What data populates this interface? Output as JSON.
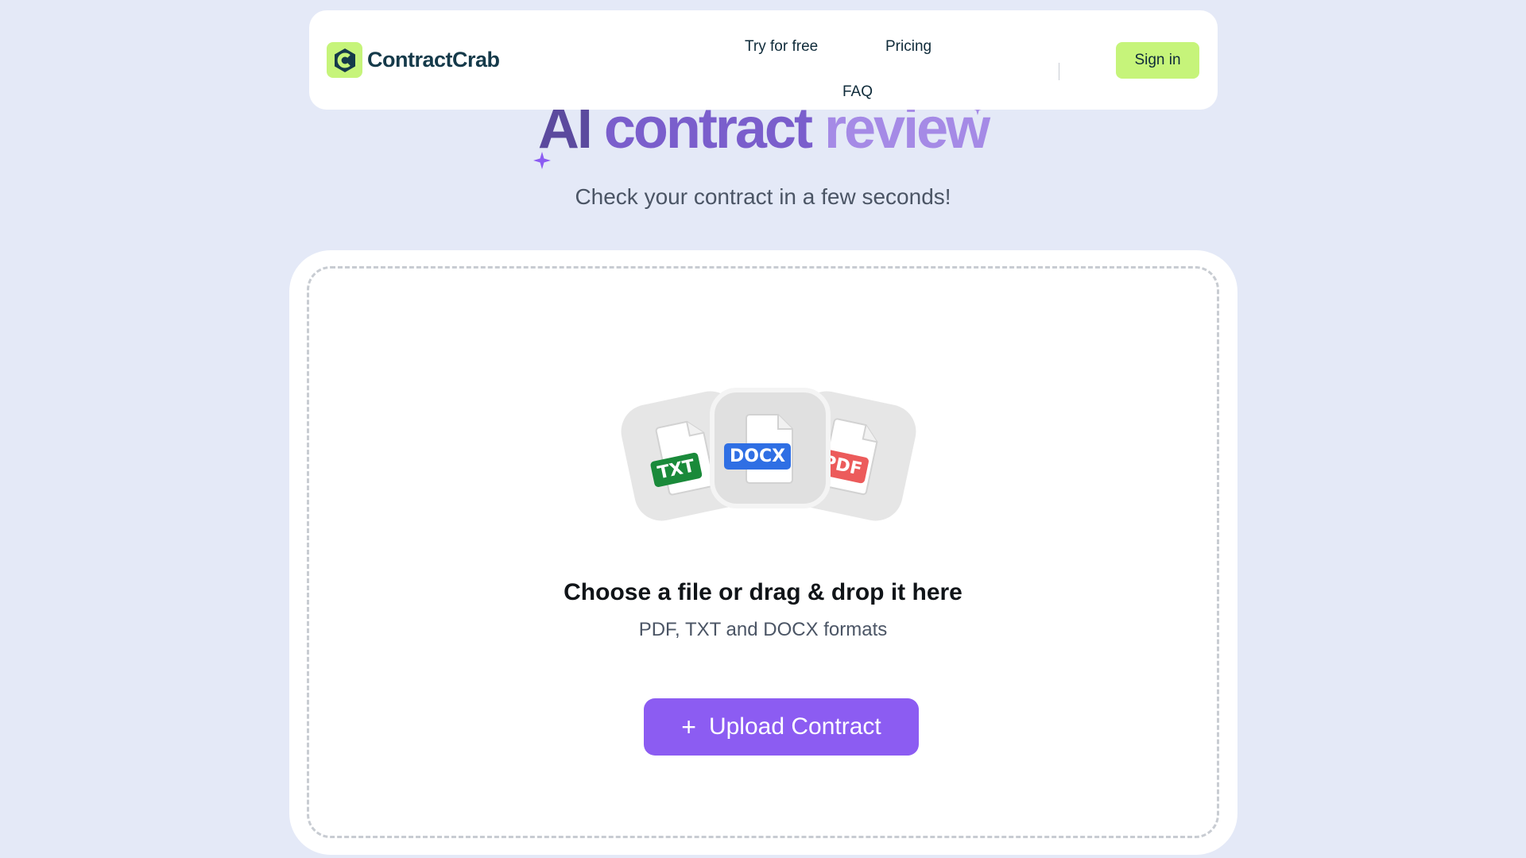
{
  "header": {
    "brand": "ContractCrab",
    "nav": {
      "try": "Try for free",
      "pricing": "Pricing",
      "faq": "FAQ"
    },
    "signin": "Sign in"
  },
  "hero": {
    "title_w1": "AI",
    "title_w2": "contract",
    "title_w3": "review",
    "subtitle": "Check your contract in a few seconds!"
  },
  "upload": {
    "formats": [
      "TXT",
      "DOCX",
      "PDF"
    ],
    "title": "Choose a file or drag & drop it here",
    "subtitle": "PDF, TXT and DOCX formats",
    "button_label": "Upload Contract",
    "button_icon": "plus-icon"
  },
  "colors": {
    "background": "#e4e9f7",
    "accent": "#8c5cf2",
    "brand_green": "#c6f47a",
    "txt_badge": "#1a8a3a",
    "docx_badge": "#2f6fe4",
    "pdf_badge": "#ec5b5b"
  }
}
